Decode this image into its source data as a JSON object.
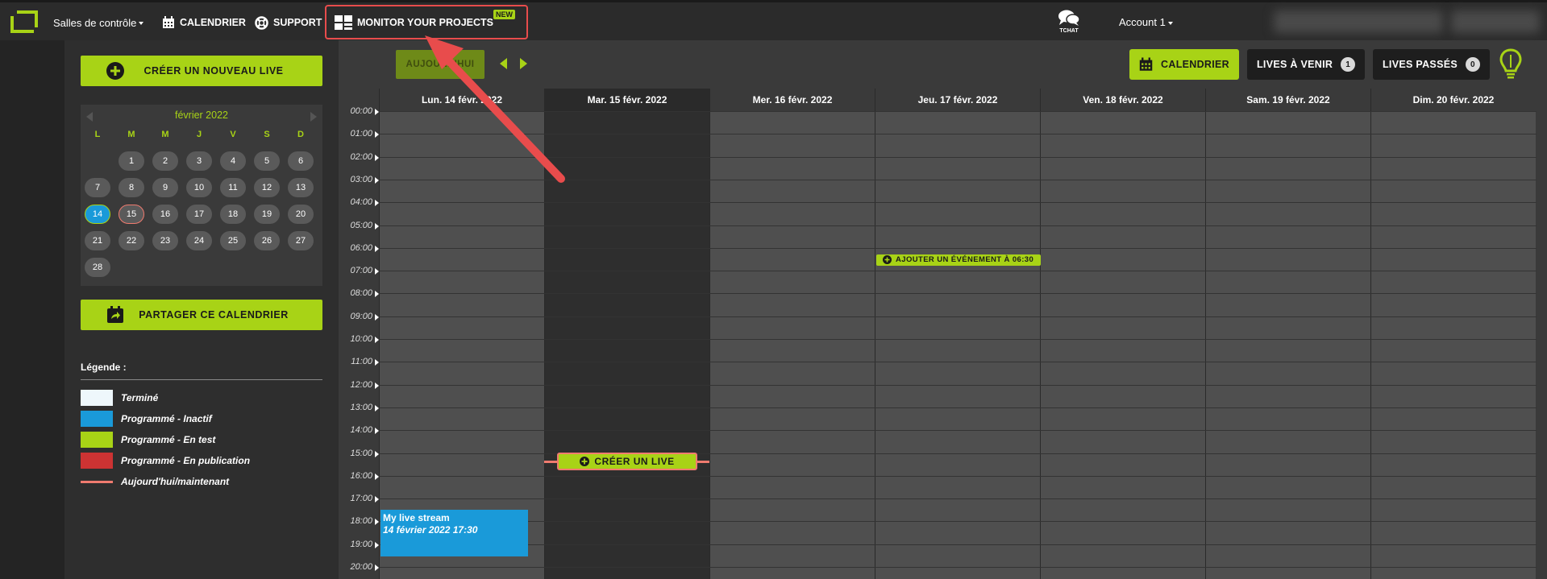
{
  "nav": {
    "rooms": "Salles de contrôle",
    "calendar": "CALENDRIER",
    "support": "SUPPORT",
    "monitor": "MONITOR YOUR PROJECTS",
    "new_badge": "NEW",
    "tchat": "TCHAT",
    "account": "Account 1"
  },
  "sidebar": {
    "create_live": "CRÉER UN NOUVEAU LIVE",
    "share_calendar": "PARTAGER CE CALENDRIER",
    "minical": {
      "month": "février 2022",
      "dow": [
        "L",
        "M",
        "M",
        "J",
        "V",
        "S",
        "D"
      ],
      "weeks": [
        [
          "",
          "1",
          "2",
          "3",
          "4",
          "5",
          "6"
        ],
        [
          "7",
          "8",
          "9",
          "10",
          "11",
          "12",
          "13"
        ],
        [
          "14",
          "15",
          "16",
          "17",
          "18",
          "19",
          "20"
        ],
        [
          "21",
          "22",
          "23",
          "24",
          "25",
          "26",
          "27"
        ],
        [
          "28",
          "",
          "",
          "",
          "",
          "",
          ""
        ]
      ]
    },
    "legend": {
      "title": "Légende :",
      "items": [
        {
          "label": "Terminé",
          "color": "#eef7fb"
        },
        {
          "label": "Programmé - Inactif",
          "color": "#1a9ad9"
        },
        {
          "label": "Programmé - En test",
          "color": "#a8d316"
        },
        {
          "label": "Programmé - En publication",
          "color": "#cc3333"
        },
        {
          "label": "Aujourd'hui/maintenant",
          "color": "#f07b6f"
        }
      ]
    }
  },
  "calendar": {
    "today_btn": "AUJOURD'HUI",
    "view_calendar": "CALENDRIER",
    "upcoming": "LIVES À VENIR",
    "upcoming_count": "1",
    "past": "LIVES PASSÉS",
    "past_count": "0",
    "days": [
      "Lun. 14 févr. 2022",
      "Mar. 15 févr. 2022",
      "Mer. 16 févr. 2022",
      "Jeu. 17 févr. 2022",
      "Ven. 18 févr. 2022",
      "Sam. 19 févr. 2022",
      "Dim. 20 févr. 2022"
    ],
    "hours": [
      "00:00",
      "01:00",
      "02:00",
      "03:00",
      "04:00",
      "05:00",
      "06:00",
      "07:00",
      "08:00",
      "09:00",
      "10:00",
      "11:00",
      "12:00",
      "13:00",
      "14:00",
      "15:00",
      "16:00",
      "17:00",
      "18:00",
      "19:00",
      "20:00"
    ],
    "add_event": "AJOUTER UN ÉVÉNEMENT À 06:30",
    "create_live": "CRÉER UN LIVE",
    "event": {
      "title": "My live stream",
      "date": "14 février 2022 17:30"
    }
  },
  "colors": {
    "accent": "#a8d316",
    "blue": "#1a9ad9",
    "now": "#f07b6f",
    "highlight": "#e84c4c"
  }
}
